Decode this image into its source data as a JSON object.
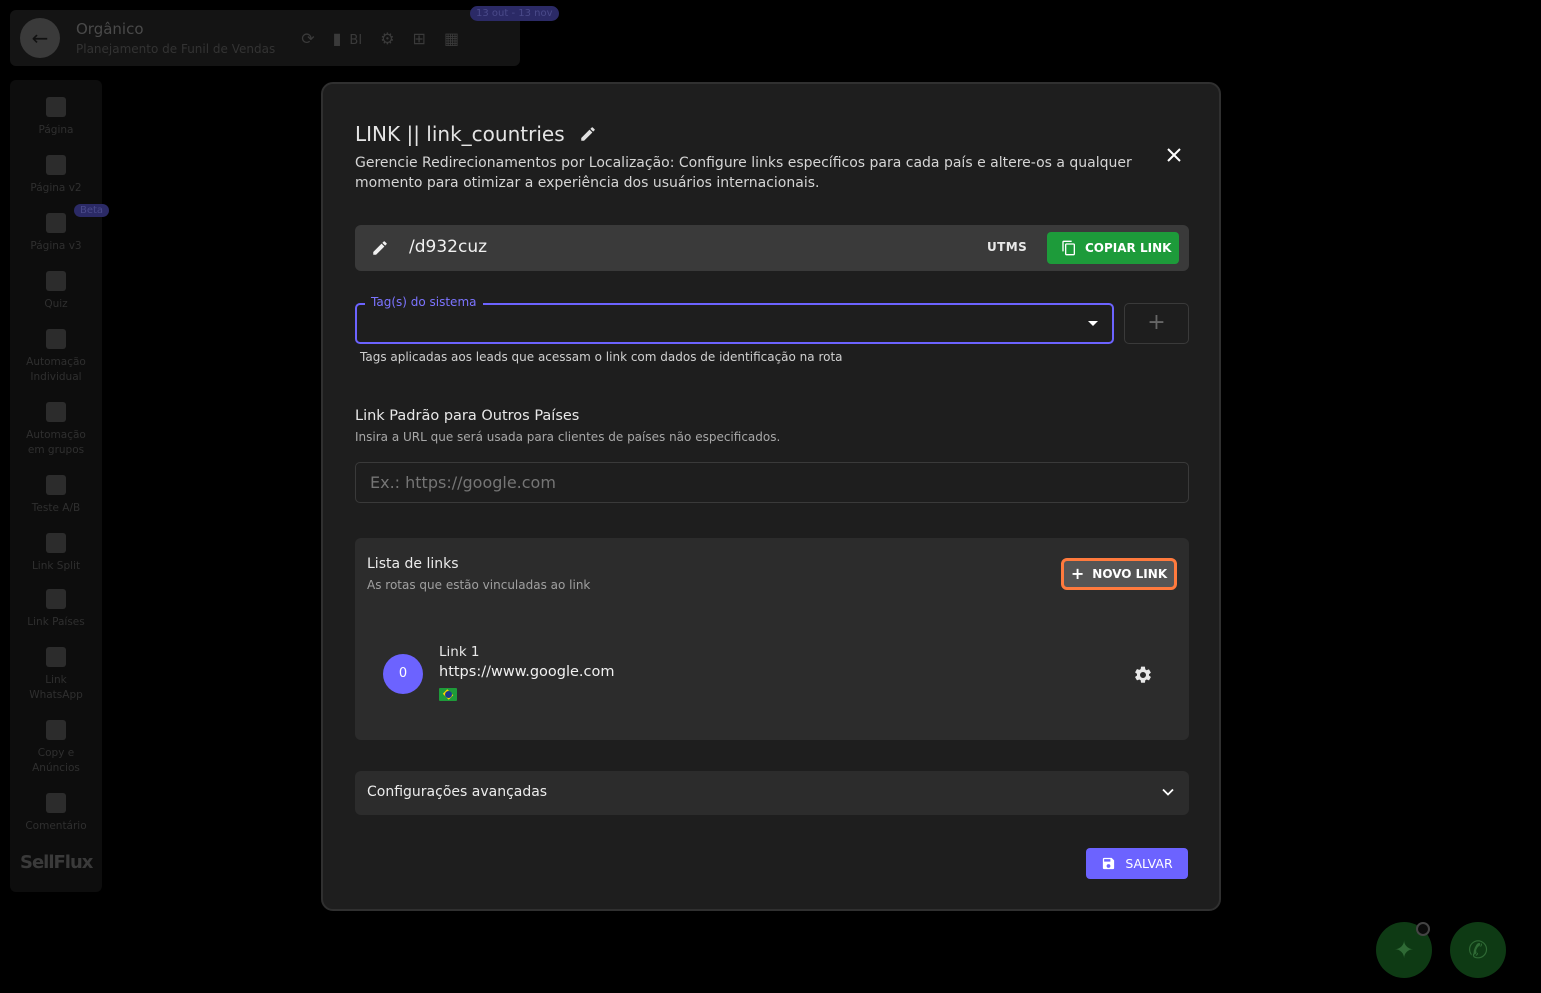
{
  "topbar": {
    "title": "Orgânico",
    "subtitle": "Planejamento de Funil de Vendas",
    "bi_label": "BI",
    "date_range": "13 out - 13 nov"
  },
  "sidebar": {
    "items": [
      {
        "label": "Página",
        "icon": "page-icon"
      },
      {
        "label": "Página v2",
        "icon": "clipboard-icon"
      },
      {
        "label": "Página v3",
        "icon": "clipboard-icon"
      },
      {
        "label": "Quiz",
        "icon": "copy-icon"
      },
      {
        "label": "Automação Individual",
        "icon": "gear-clock-icon"
      },
      {
        "label": "Automação em grupos",
        "icon": "refresh-icon"
      },
      {
        "label": "Teste A/B",
        "icon": "flask-icon"
      },
      {
        "label": "Link Split",
        "icon": "link-icon"
      },
      {
        "label": "Link Países",
        "icon": "globe-icon"
      },
      {
        "label": "Link WhatsApp",
        "icon": "fork-icon"
      },
      {
        "label": "Copy e Anúncios",
        "icon": "ticket-icon"
      },
      {
        "label": "Comentário",
        "icon": "comment-icon"
      }
    ],
    "beta_badge": "Beta",
    "logo": "SellFlux"
  },
  "modal": {
    "title": "LINK || link_countries",
    "description": "Gerencie Redirecionamentos por Localização: Configure links específicos para cada país e altere-os a qualquer momento para otimizar a experiência dos usuários internacionais.",
    "link_path": "/d932cuz",
    "utms_label": "UTMS",
    "copy_label": "COPIAR LINK",
    "tags": {
      "label": "Tag(s) do sistema",
      "value": "",
      "help": "Tags aplicadas aos leads que acessam o link com dados de identificação na rota"
    },
    "default_link": {
      "title": "Link Padrão para Outros Países",
      "subtitle": "Insira a URL que será usada para clientes de países não especificados.",
      "placeholder": "Ex.: https://google.com",
      "value": ""
    },
    "links_list": {
      "title": "Lista de links",
      "subtitle": "As rotas que estão vinculadas ao link",
      "new_button": "NOVO LINK",
      "items": [
        {
          "index": "0",
          "name": "Link 1",
          "url": "https://www.google.com",
          "flag": "brazil-flag-icon"
        }
      ]
    },
    "advanced": {
      "label": "Configurações avançadas"
    },
    "save_label": "SALVAR"
  },
  "colors": {
    "accent": "#6c63ff",
    "copy_green": "#1d9b3a",
    "highlight_orange": "#ff7a3d",
    "background": "#1e1e1e"
  }
}
